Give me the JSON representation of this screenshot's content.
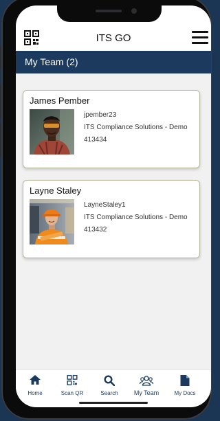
{
  "app": {
    "title": "ITS GO"
  },
  "header": {
    "title": "My Team (2)"
  },
  "team": [
    {
      "name": "James Pember",
      "username": "jpember23",
      "company": "ITS Compliance Solutions - Demo",
      "id": "413434"
    },
    {
      "name": "Layne Staley",
      "username": "LayneStaley1",
      "company": "ITS Compliance Solutions - Demo",
      "id": "413432"
    }
  ],
  "tabs": [
    {
      "label": "Home",
      "icon": "home-icon"
    },
    {
      "label": "Scan QR",
      "icon": "qr-code-icon"
    },
    {
      "label": "Search",
      "icon": "search-icon"
    },
    {
      "label": "My Team",
      "icon": "team-icon",
      "active": true
    },
    {
      "label": "My Docs",
      "icon": "document-icon"
    }
  ],
  "colors": {
    "navy": "#1c3a5e",
    "background": "#1b3654",
    "card_border": "#b9b99a"
  }
}
